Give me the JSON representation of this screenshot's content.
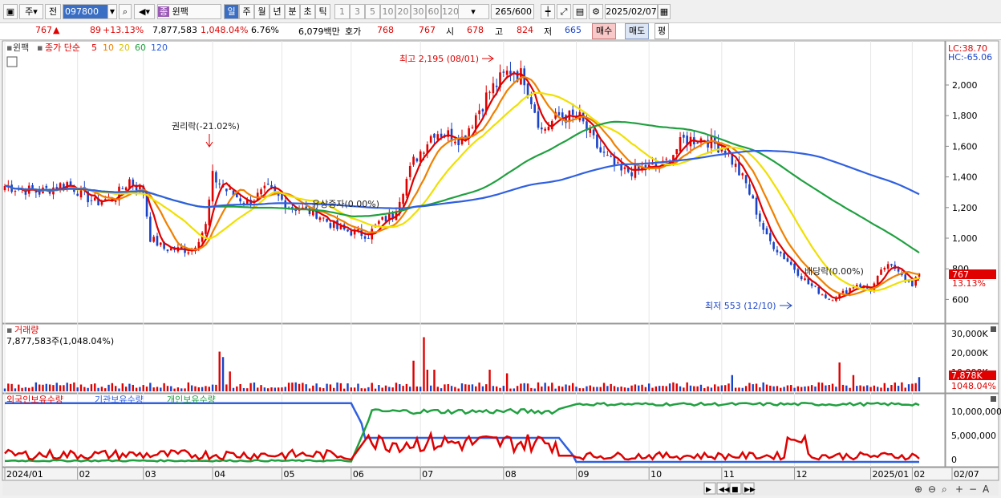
{
  "toolbar": {
    "market_a": "주",
    "market_b": "전",
    "code": "097800",
    "stock_badge": "종",
    "stock_name": "윈팩",
    "periods": [
      "일",
      "주",
      "월",
      "년",
      "분",
      "초",
      "틱"
    ],
    "active_period": "일",
    "intervals": [
      "1",
      "3",
      "5",
      "10",
      "20",
      "30",
      "60",
      "120"
    ],
    "count": "265",
    "total": "/600",
    "date": "2025/02/07"
  },
  "quote": {
    "price": "767",
    "change": "89",
    "change_pct": "+13.13%",
    "volume": "7,877,583",
    "volume_pct": "1,048.04%",
    "turnover": "6.76%",
    "amount": "6,079백만",
    "hoga_label": "호가",
    "ask": "768",
    "bid": "767",
    "open_label": "시",
    "open": "678",
    "high_label": "고",
    "high": "824",
    "low_label": "저",
    "low": "665",
    "buy_button": "매수",
    "sell_button": "매도",
    "eval_button": "평"
  },
  "price_panel": {
    "name": "윈팩",
    "ma_label": "종가 단순",
    "ma_periods": [
      "5",
      "10",
      "20",
      "60",
      "120"
    ],
    "ma_colors": [
      "#e00000",
      "#f08000",
      "#f0e000",
      "#20a040",
      "#3060e0"
    ],
    "lc": "LC:38.70",
    "hc": "HC:-65.06",
    "y_ticks": [
      "2,000",
      "1,800",
      "1,600",
      "1,400",
      "1,200",
      "1,000",
      "800",
      "600"
    ],
    "last_price": "767",
    "last_pct": "13.13%",
    "annotations": {
      "high": "최고 2,195 (08/01)",
      "low": "최저 553 (12/10)",
      "rights": "권리락(-21.02%)",
      "capital": "유상증자(0.00%)",
      "dividend": "배당락(0.00%)"
    }
  },
  "volume_panel": {
    "title": "거래량",
    "value": "7,877,583주(1,048.04%)",
    "y_ticks": [
      "30,000K",
      "20,000K",
      "10,000K"
    ],
    "last_vol": "7,878K",
    "last_pct": "1048.04%"
  },
  "holder_panel": {
    "legend": [
      "외국인보유수량",
      "기관보유수량",
      "개인보유수량"
    ],
    "y_ticks": [
      "10,000,000",
      "5,000,000",
      "0"
    ]
  },
  "x_axis": [
    "2024/01",
    "02",
    "03",
    "04",
    "05",
    "06",
    "07",
    "08",
    "09",
    "10",
    "11",
    "12",
    "2025/01",
    "02",
    "02/07"
  ]
}
